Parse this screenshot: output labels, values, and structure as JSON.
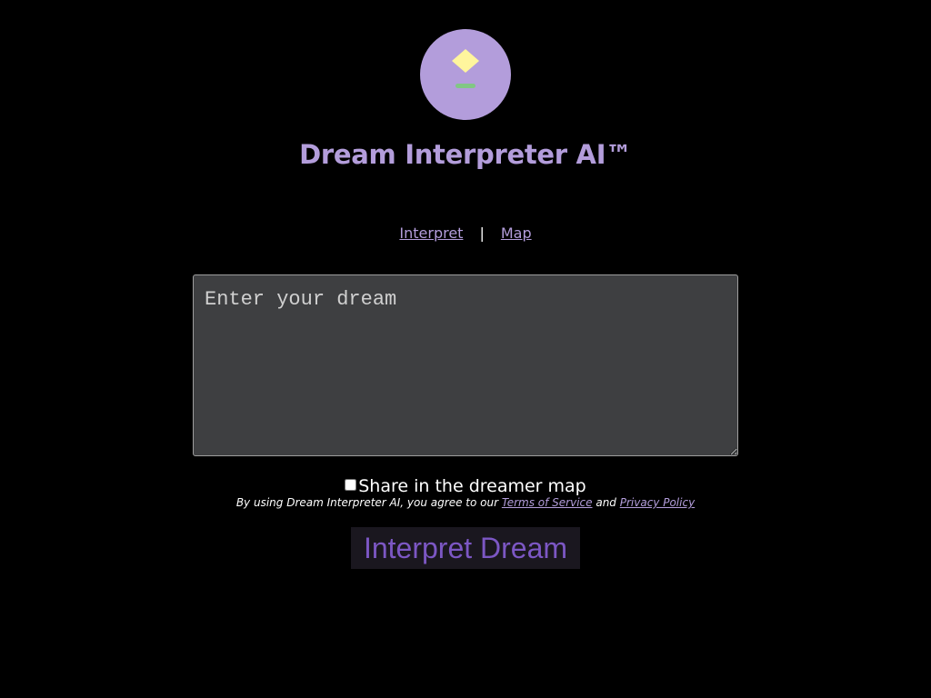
{
  "app": {
    "title": "Dream Interpreter AI™",
    "logo_icon": "moon-star-logo-icon"
  },
  "nav": {
    "items": [
      {
        "label": "Interpret"
      },
      {
        "label": "Map"
      }
    ],
    "separator": "|"
  },
  "form": {
    "dream_placeholder": "Enter your dream",
    "dream_value": "",
    "share_label": "Share in the dreamer map",
    "share_checked": false,
    "terms_prefix": "By using Dream Interpreter AI, you agree to our",
    "terms_link": "Terms of Service",
    "terms_and": "and",
    "privacy_link": "Privacy Policy",
    "submit_label": "Interpret Dream"
  },
  "colors": {
    "background": "#000000",
    "accent": "#b39ddb",
    "button_text": "#7c57c4",
    "input_bg": "#3e3f41"
  }
}
